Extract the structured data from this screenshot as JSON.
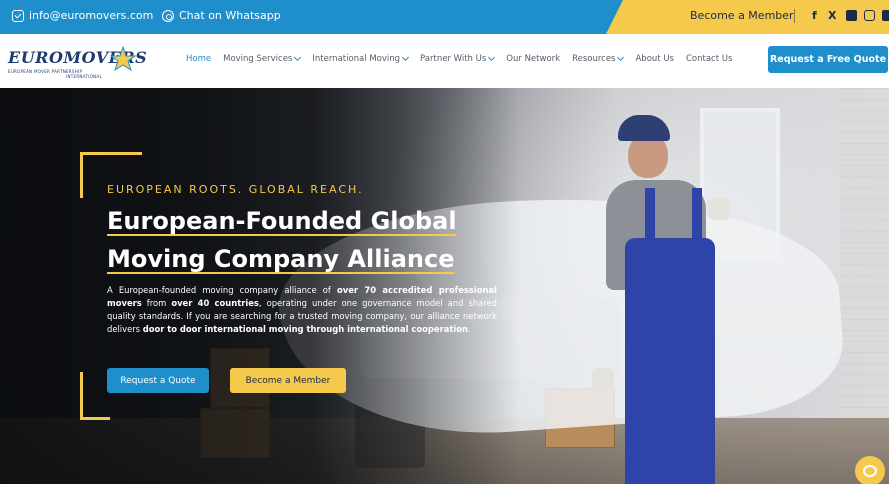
{
  "topbar": {
    "email": "info@euromovers.com",
    "whatsapp": "Chat on Whatsapp",
    "member": "Become a Member",
    "social": [
      "f",
      "X"
    ]
  },
  "logo": {
    "main": "EUROMOVERS",
    "sub": "EUROPEAN MOVER PARTNERSHIP",
    "sub2": "INTERNATIONAL"
  },
  "nav": {
    "items": [
      {
        "label": "Home",
        "active": true,
        "dropdown": false
      },
      {
        "label": "Moving Services",
        "active": false,
        "dropdown": true
      },
      {
        "label": "International Moving",
        "active": false,
        "dropdown": true
      },
      {
        "label": "Partner With Us",
        "active": false,
        "dropdown": true
      },
      {
        "label": "Our Network",
        "active": false,
        "dropdown": false
      },
      {
        "label": "Resources",
        "active": false,
        "dropdown": true
      },
      {
        "label": "About Us",
        "active": false,
        "dropdown": false
      },
      {
        "label": "Contact Us",
        "active": false,
        "dropdown": false
      }
    ],
    "cta": "Request a Free Quote"
  },
  "hero": {
    "eyebrow": "EUROPEAN ROOTS. GLOBAL REACH.",
    "headline_line1": "European-Founded Global",
    "headline_line2": "Moving Company Alliance",
    "desc_parts": [
      {
        "t": "A European-founded moving company alliance of ",
        "b": false
      },
      {
        "t": "over 70 accredited professional movers",
        "b": true
      },
      {
        "t": " from ",
        "b": false
      },
      {
        "t": "over 40 countries",
        "b": true
      },
      {
        "t": ", operating under one governance model and shared quality standards. If you are searching for a trusted moving company, our alliance network delivers ",
        "b": false
      },
      {
        "t": "door to door international moving through international cooperation",
        "b": true
      },
      {
        "t": ".",
        "b": false
      }
    ],
    "btn_quote": "Request a Quote",
    "btn_member": "Become a Member"
  },
  "colors": {
    "blue": "#1f8fcc",
    "yellow": "#f5c94c",
    "navy": "#1c2a44"
  }
}
